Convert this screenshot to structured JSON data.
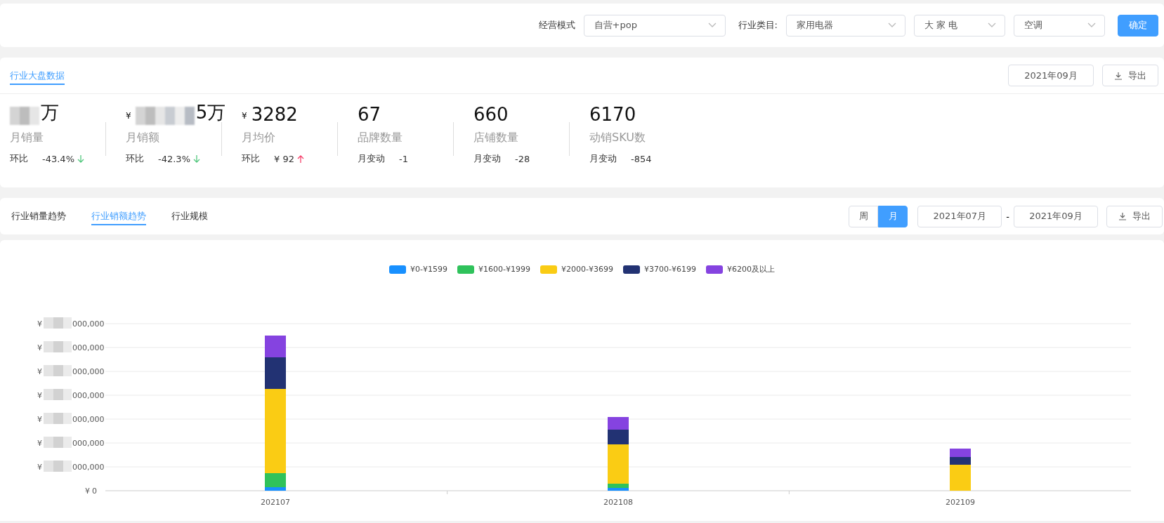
{
  "filters": {
    "mode_label": "经营模式",
    "mode": "自营+pop",
    "category_label": "行业类目:",
    "selects": [
      "家用电器",
      "大 家 电",
      "空调"
    ],
    "confirm": "确定"
  },
  "overview": {
    "tab": "行业大盘数据",
    "month": "2021年09月",
    "export": "导出",
    "metrics": [
      {
        "redacted": true,
        "value": "万",
        "label": "月销量",
        "change_label": "环比",
        "change": "-43.4%",
        "rising": false
      },
      {
        "currency": "¥",
        "redacted": true,
        "value": "5万",
        "label": "月销额",
        "change_label": "环比",
        "change": "-42.3%",
        "rising": false
      },
      {
        "currency": "¥",
        "redacted": false,
        "value": "3282",
        "label": "月均价",
        "change_label": "环比",
        "change": "¥ 92",
        "rising": true
      },
      {
        "redacted": false,
        "value": "67",
        "label": "品牌数量",
        "change_label": "月变动",
        "change": "-1"
      },
      {
        "redacted": false,
        "value": "660",
        "label": "店铺数量",
        "change_label": "月变动",
        "change": "-28"
      },
      {
        "redacted": false,
        "value": "6170",
        "label": "动销SKU数",
        "change_label": "月变动",
        "change": "-854"
      }
    ]
  },
  "trend": {
    "tabs": [
      {
        "label": "行业销量趋势",
        "selected": false
      },
      {
        "label": "行业销额趋势",
        "selected": true
      },
      {
        "label": "行业规模",
        "selected": false
      }
    ],
    "period": [
      {
        "label": "周",
        "selected": false
      },
      {
        "label": "月",
        "selected": true
      }
    ],
    "range": {
      "start": "2021年07月",
      "separator": "-",
      "end": "2021年09月"
    },
    "export": "导出"
  },
  "chart": {
    "legend": [
      {
        "label": "¥0-¥1599",
        "color": "#1890ff"
      },
      {
        "label": "¥1600-¥1999",
        "color": "#2fc25b"
      },
      {
        "label": "¥2000-¥3699",
        "color": "#facc14"
      },
      {
        "label": "¥3700-¥6199",
        "color": "#223273"
      },
      {
        "label": "¥6200及以上",
        "color": "#8543e0"
      }
    ],
    "y_ticks": [
      {
        "prefix": "¥",
        "suffix": "000,000",
        "redacted": true
      },
      {
        "prefix": "¥",
        "suffix": "000,000",
        "redacted": true
      },
      {
        "prefix": "¥",
        "suffix": "000,000",
        "redacted": true
      },
      {
        "prefix": "¥",
        "suffix": "000,000",
        "redacted": true
      },
      {
        "prefix": "¥",
        "suffix": "000,000",
        "redacted": true
      },
      {
        "prefix": "¥",
        "suffix": "000,000",
        "redacted": true
      },
      {
        "prefix": "¥",
        "suffix": "000,000",
        "redacted": true
      },
      {
        "prefix": "¥",
        "suffix": "0",
        "redacted": false
      }
    ],
    "categories": [
      "202107",
      "202108",
      "202109"
    ]
  }
}
